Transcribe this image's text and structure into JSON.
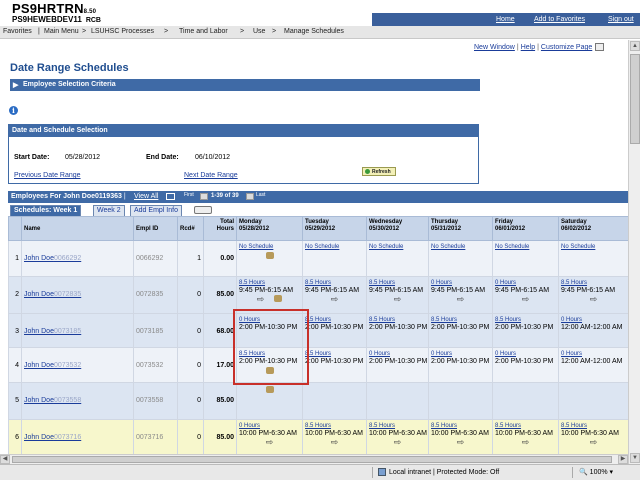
{
  "header": {
    "app_title": "PS9HRTRN",
    "version": "8.50",
    "database": "PS9HEWEBDEV11",
    "user_code": "RCB",
    "links": [
      "Home",
      "Add to Favorites",
      "Sign out"
    ]
  },
  "nav": [
    "Favorites",
    "Main Menu",
    ">",
    "LSUHSC Processes",
    ">",
    "Time and Labor",
    ">",
    "Use",
    ">",
    "Manage Schedules"
  ],
  "page_links": [
    "New Window",
    "Help",
    "Customize Page"
  ],
  "page_title": "Date Range Schedules",
  "criteria_section": "Employee Selection Criteria",
  "date_section": {
    "title": "Date and Schedule Selection",
    "start_label": "Start Date:",
    "start_value": "05/28/2012",
    "end_label": "End Date:",
    "end_value": "06/10/2012",
    "prev_link": "Previous Date Range",
    "next_link": "Next Date Range",
    "refresh_label": "Refresh"
  },
  "employees_bar": {
    "title": "Employees For John Doe0119363",
    "view_all": "View All",
    "first": "First",
    "range": "1-39 of 39",
    "last": "Last"
  },
  "tabs": [
    "Schedules: Week 1",
    "Week 2",
    "Add Empl Info"
  ],
  "columns": {
    "name": "Name",
    "emplid": "Empl ID",
    "rcd": "Rcd#",
    "total1": "Total",
    "total2": "Hours",
    "days": [
      {
        "d": "Monday",
        "dt": "05/28/2012"
      },
      {
        "d": "Tuesday",
        "dt": "05/29/2012"
      },
      {
        "d": "Wednesday",
        "dt": "05/30/2012"
      },
      {
        "d": "Thursday",
        "dt": "05/31/2012"
      },
      {
        "d": "Friday",
        "dt": "06/01/2012"
      },
      {
        "d": "Saturday",
        "dt": "06/02/2012"
      }
    ]
  },
  "rows": [
    {
      "n": "1",
      "name": "John Doe",
      "nid": "0066292",
      "emplid": "0066292",
      "rcd": "1",
      "hrs": "0.00",
      "cells": [
        [
          "No Schedule",
          "",
          "i"
        ],
        [
          "No Schedule",
          "",
          ""
        ],
        [
          "No Schedule",
          "",
          ""
        ],
        [
          "No Schedule",
          "",
          ""
        ],
        [
          "No Schedule",
          "",
          ""
        ],
        [
          "No Schedule",
          "",
          ""
        ]
      ]
    },
    {
      "n": "2",
      "name": "John Doe",
      "nid": "0072835",
      "emplid": "0072835",
      "rcd": "0",
      "hrs": "85.00",
      "cells": [
        [
          "8.5 Hours",
          "9:45 PM-6:15 AM",
          "ai"
        ],
        [
          "8.5 Hours",
          "9:45 PM-6:15 AM",
          "a"
        ],
        [
          "8.5 Hours",
          "9:45 PM-6:15 AM",
          "a"
        ],
        [
          "0 Hours",
          "9:45 PM-6:15 AM",
          "a"
        ],
        [
          "0 Hours",
          "9:45 PM-6:15 AM",
          "a"
        ],
        [
          "8.5 Hours",
          "9:45 PM-6:15 AM",
          "a"
        ]
      ]
    },
    {
      "n": "3",
      "name": "John Doe",
      "nid": "0073185",
      "emplid": "0073185",
      "rcd": "0",
      "hrs": "68.00",
      "cells": [
        [
          "0 Hours",
          "2:00 PM-10:30 PM",
          ""
        ],
        [
          "8.5 Hours",
          "2:00 PM-10:30 PM",
          ""
        ],
        [
          "8.5 Hours",
          "2:00 PM-10:30 PM",
          ""
        ],
        [
          "8.5 Hours",
          "2:00 PM-10:30 PM",
          ""
        ],
        [
          "8.5 Hours",
          "2:00 PM-10:30 PM",
          ""
        ],
        [
          "0 Hours",
          "12:00 AM-12:00 AM",
          ""
        ]
      ]
    },
    {
      "n": "4",
      "name": "John Doe",
      "nid": "0073532",
      "emplid": "0073532",
      "rcd": "0",
      "hrs": "17.00",
      "cells": [
        [
          "8.5 Hours",
          "2:00 PM-10:30 PM",
          "i"
        ],
        [
          "8.5 Hours",
          "2:00 PM-10:30 PM",
          ""
        ],
        [
          "0 Hours",
          "2:00 PM-10:30 PM",
          ""
        ],
        [
          "0 Hours",
          "2:00 PM-10:30 PM",
          ""
        ],
        [
          "0 Hours",
          "2:00 PM-10:30 PM",
          ""
        ],
        [
          "0 Hours",
          "12:00 AM-12:00 AM",
          ""
        ]
      ]
    },
    {
      "n": "5",
      "name": "John Doe",
      "nid": "0073558",
      "emplid": "0073558",
      "rcd": "0",
      "hrs": "85.00",
      "cells": [
        [
          "",
          "",
          "i"
        ],
        [
          "",
          "",
          ""
        ],
        [
          "",
          "",
          ""
        ],
        [
          "",
          "",
          ""
        ],
        [
          "",
          "",
          ""
        ],
        [
          "",
          "",
          ""
        ]
      ]
    },
    {
      "n": "6",
      "name": "John Doe",
      "nid": "0073716",
      "emplid": "0073716",
      "rcd": "0",
      "hrs": "85.00",
      "cells": [
        [
          "0 Hours",
          "10:00 PM-6:30 AM",
          "a"
        ],
        [
          "8.5 Hours",
          "10:00 PM-6:30 AM",
          "a"
        ],
        [
          "8.5 Hours",
          "10:00 PM-6:30 AM",
          "a"
        ],
        [
          "8.5 Hours",
          "10:00 PM-6:30 AM",
          "a"
        ],
        [
          "8.5 Hours",
          "10:00 PM-6:30 AM",
          "a"
        ],
        [
          "8.5 Hours",
          "10:00 PM-6:30 AM",
          "a"
        ]
      ]
    }
  ],
  "status": {
    "zone": "Local intranet | Protected Mode: Off",
    "zoom": "100%"
  },
  "colors": {
    "brand_blue": "#3f6aa6",
    "highlight_red": "#c8302a",
    "row_yellow": "#f7f7cc"
  }
}
